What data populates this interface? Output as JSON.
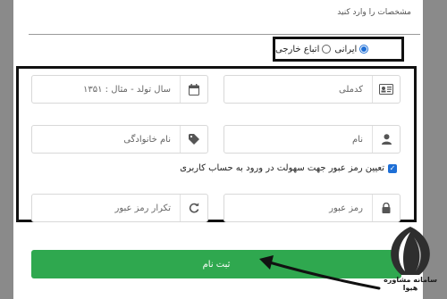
{
  "section": {
    "label": "مشخصات را وارد کنید"
  },
  "nationality": {
    "options": [
      {
        "label": "ایرانی",
        "selected": true
      },
      {
        "label": "اتباع خارجی",
        "selected": false
      }
    ]
  },
  "form": {
    "national_code": {
      "placeholder": "کدملی",
      "icon": "id-card-icon"
    },
    "birth_year": {
      "placeholder": "سال تولد - مثال : ۱۳۵۱",
      "icon": "calendar-icon"
    },
    "first_name": {
      "placeholder": "نام",
      "icon": "user-icon"
    },
    "last_name": {
      "placeholder": "نام خانوادگی",
      "icon": "tag-icon"
    },
    "set_password_label": "تعیین رمز عبور جهت سهولت در ورود به حساب کاربری",
    "set_password_checked": true,
    "password": {
      "placeholder": "رمز عبور",
      "icon": "lock-icon"
    },
    "password_repeat": {
      "placeholder": "تکرار رمز عبور",
      "icon": "refresh-icon"
    }
  },
  "submit": {
    "label": "ثبت نام"
  },
  "watermark": {
    "text": "سامانه مشاوره هیوا"
  },
  "colors": {
    "accent_blue": "#1e6fd6",
    "submit_green": "#2fa84f",
    "annotation_black": "#111111",
    "page_gray": "#8a8a8a"
  }
}
